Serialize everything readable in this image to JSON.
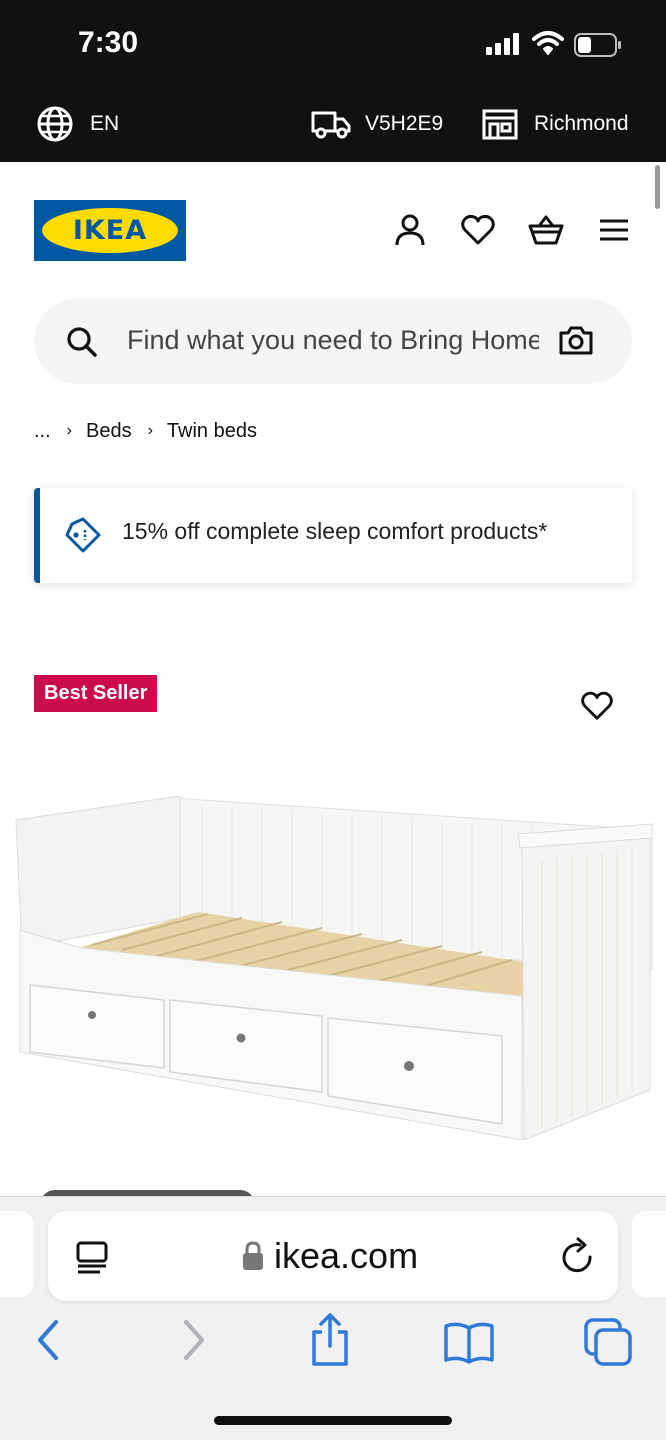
{
  "status_bar": {
    "time": "7:30"
  },
  "top_bar": {
    "language": "EN",
    "postal_code": "V5H2E9",
    "store": "Richmond"
  },
  "header": {
    "logo_text": "IKEA",
    "logo_reg": "®",
    "search_placeholder": "Find what you need to Bring Home"
  },
  "breadcrumb": {
    "ellipsis": "...",
    "items": [
      "Beds",
      "Twin beds"
    ]
  },
  "promo": {
    "text": "15% off complete sleep comfort products*"
  },
  "product": {
    "badge": "Best Seller"
  },
  "browser": {
    "url": "ikea.com"
  },
  "colors": {
    "ikea_blue": "#0058a3",
    "ikea_yellow": "#ffdb00",
    "badge_red": "#cc0a4e",
    "safari_blue": "#2f7ad8"
  },
  "icons": [
    "globe-icon",
    "truck-icon",
    "store-icon",
    "user-icon",
    "heart-icon",
    "basket-icon",
    "menu-icon",
    "search-icon",
    "camera-icon",
    "price-tag-icon",
    "reader-icon",
    "lock-icon",
    "reload-icon",
    "back-icon",
    "forward-icon",
    "share-icon",
    "bookmarks-icon",
    "tabs-icon"
  ]
}
